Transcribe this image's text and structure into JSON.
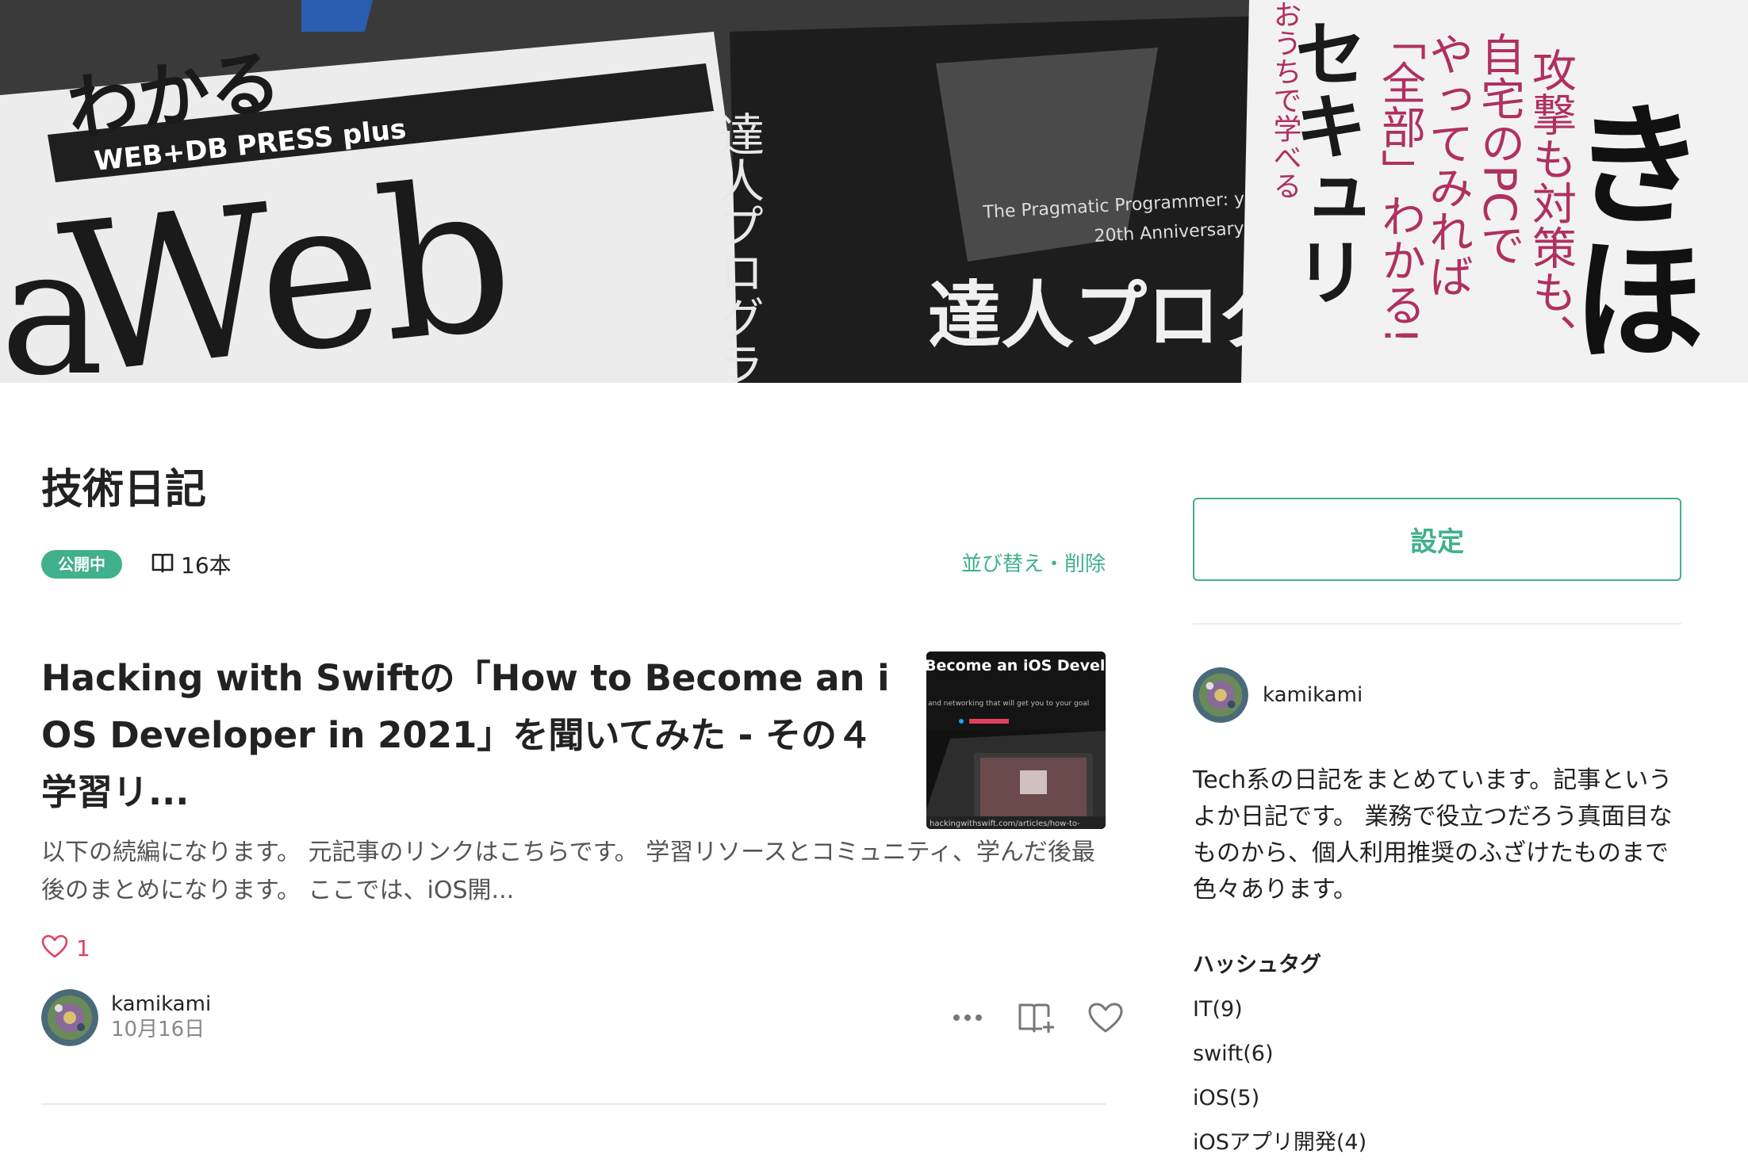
{
  "header": {
    "cover_image": "books-cover-photo"
  },
  "magazine": {
    "title": "技術日記",
    "status_badge": "公開中",
    "article_count": "16本",
    "sort_delete_label": "並び替え・削除"
  },
  "article": {
    "title": "Hacking with Swiftの「How to Become an iOS Developer in 2021」を聞いてみた - その４ 学習リ...",
    "thumbnail_text": "Become an iOS Devel",
    "thumbnail_subtext": "and networking that will get you to your goal",
    "excerpt": "以下の続編になります。 元記事のリンクはこちらです。 学習リソースとコミュニティ、学んだ後最後のまとめになります。 ここでは、iOS開...",
    "like_count": "1",
    "author": "kamikami",
    "date": "10月16日",
    "icons": {
      "like": "heart-icon",
      "more": "more-icon",
      "add_to_magazine": "add-magazine-icon",
      "like_button": "heart-outline-icon"
    }
  },
  "sidebar": {
    "settings_label": "設定",
    "author": "kamikami",
    "description": "Tech系の日記をまとめています。記事というよか日記です。 業務で役立つだろう真面目なものから、個人利用推奨のふざけたものまで色々あります。",
    "hashtag_heading": "ハッシュタグ",
    "hashtags": [
      "IT(9)",
      "swift(6)",
      "iOS(5)",
      "iOSアプリ開発(4)"
    ]
  },
  "colors": {
    "accent": "#41b08c",
    "like": "#e04060",
    "text": "#222222",
    "muted": "#888888"
  }
}
